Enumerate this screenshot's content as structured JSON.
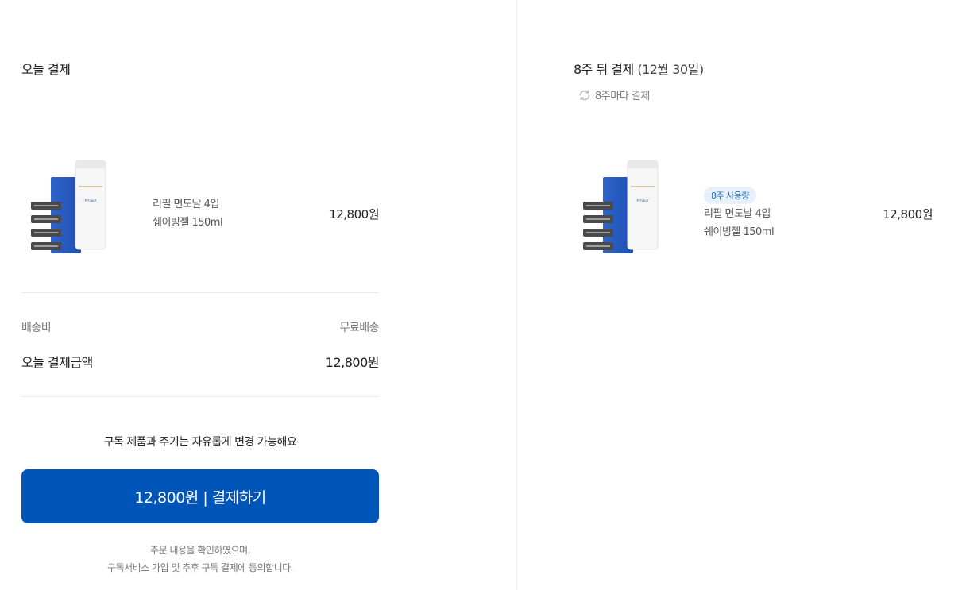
{
  "today": {
    "title": "오늘 결제",
    "product": {
      "image_name": "razor-refill-and-shaving-gel",
      "brand_text": "MYSELY",
      "names": [
        "리필 면도날 4입",
        "쉐이빙젤 150ml"
      ],
      "price": "12,800원"
    },
    "shipping_label": "배송비",
    "shipping_value": "무료배송",
    "total_label": "오늘 결제금액",
    "total_value": "12,800원",
    "notice": "구독 제품과 주기는 자유롭게 변경 가능해요",
    "pay_button_label": "12,800원 | 결제하기",
    "agree_lines": [
      "주문 내용을 확인하였으며,",
      "구독서비스 가입 및 추후 구독 결제에 동의합니다."
    ]
  },
  "next": {
    "title": "8주 뒤 결제",
    "date": "(12월 30일)",
    "cycle_icon": "refresh-icon",
    "cycle_text": "8주마다 결제",
    "product": {
      "image_name": "razor-refill-and-shaving-gel",
      "brand_text": "MYSELY",
      "badge": "8주 사용량",
      "names": [
        "리필 면도날 4입",
        "쉐이빙젤 150ml"
      ],
      "price": "12,800원"
    }
  },
  "colors": {
    "primary": "#0055b8",
    "badge_bg": "#e6f1fb",
    "badge_text": "#2a6cb8",
    "divider": "#ececec"
  }
}
